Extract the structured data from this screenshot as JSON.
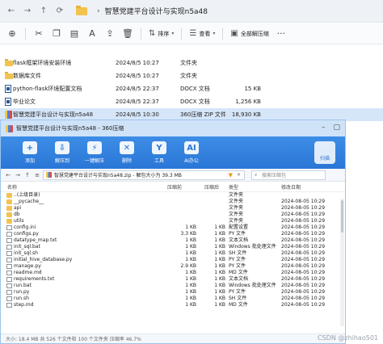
{
  "explorer": {
    "path": "智慧党建平台设计与实现n5a48",
    "toolbar": {
      "sort_label": "排序",
      "view_label": "查看",
      "extract_label": "全部解压缩"
    },
    "files": [
      {
        "name": "flask框架环境安装环境",
        "date": "2024/8/5 10:27",
        "type": "文件夹",
        "size": "",
        "icon": "folder"
      },
      {
        "name": "数据库文件",
        "date": "2024/8/5 10:27",
        "type": "文件夹",
        "size": "",
        "icon": "folder"
      },
      {
        "name": "python-flask环境配置文档",
        "date": "2024/8/5 22:37",
        "type": "DOCX 文档",
        "size": "15 KB",
        "icon": "doc"
      },
      {
        "name": "毕业论文",
        "date": "2024/8/5 22:37",
        "type": "DOCX 文档",
        "size": "1,256 KB",
        "icon": "doc"
      },
      {
        "name": "智慧党建平台设计与实现n5a48",
        "date": "2024/8/5 10:30",
        "type": "360压缩 ZIP 文件",
        "size": "18,930 KB",
        "icon": "zip"
      }
    ]
  },
  "zip": {
    "title": "智慧党建平台设计与实现n5a48 - 360压缩",
    "tools": [
      "添加",
      "解压到",
      "一键解压",
      "删除",
      "工具",
      "AI办公"
    ],
    "scan_label": "扫描",
    "address": "智慧党建平台设计与实现n5a48.zip - 解包大小为 39.3 MB",
    "search_placeholder": "搜索压缩包",
    "headers": {
      "name": "名称",
      "size": "压缩前",
      "compressed": "压缩后",
      "type": "类型",
      "modified": "修改日期"
    },
    "rows": [
      {
        "name": "..(上级目录)",
        "size": "",
        "compressed": "",
        "type": "文件夹",
        "modified": "",
        "icon": "folder"
      },
      {
        "name": "__pycache__",
        "size": "",
        "compressed": "",
        "type": "文件夹",
        "modified": "2024-08-05 10:29",
        "icon": "folder"
      },
      {
        "name": "api",
        "size": "",
        "compressed": "",
        "type": "文件夹",
        "modified": "2024-08-05 10:29",
        "icon": "folder"
      },
      {
        "name": "db",
        "size": "",
        "compressed": "",
        "type": "文件夹",
        "modified": "2024-08-05 10:29",
        "icon": "folder"
      },
      {
        "name": "utils",
        "size": "",
        "compressed": "",
        "type": "文件夹",
        "modified": "2024-08-05 10:29",
        "icon": "folder"
      },
      {
        "name": "config.ini",
        "size": "1 KB",
        "compressed": "1 KB",
        "type": "配置设置",
        "modified": "2024-08-05 10:29",
        "icon": "doc"
      },
      {
        "name": "configs.py",
        "size": "3.3 KB",
        "compressed": "1 KB",
        "type": "PY 文件",
        "modified": "2024-08-05 10:29",
        "icon": "doc"
      },
      {
        "name": "datatype_map.txt",
        "size": "1 KB",
        "compressed": "1 KB",
        "type": "文本文档",
        "modified": "2024-08-05 10:29",
        "icon": "doc"
      },
      {
        "name": "init_sql.bat",
        "size": "1 KB",
        "compressed": "1 KB",
        "type": "Windows 批处理文件",
        "modified": "2024-08-05 10:29",
        "icon": "doc"
      },
      {
        "name": "init_sql.sh",
        "size": "1 KB",
        "compressed": "1 KB",
        "type": "SH 文件",
        "modified": "2024-08-05 10:29",
        "icon": "doc"
      },
      {
        "name": "initial_hive_database.py",
        "size": "1 KB",
        "compressed": "1 KB",
        "type": "PY 文件",
        "modified": "2024-08-05 10:29",
        "icon": "doc"
      },
      {
        "name": "manage.py",
        "size": "2.9 KB",
        "compressed": "1 KB",
        "type": "PY 文件",
        "modified": "2024-08-05 10:29",
        "icon": "doc"
      },
      {
        "name": "readme.md",
        "size": "1 KB",
        "compressed": "1 KB",
        "type": "MD 文件",
        "modified": "2024-08-05 10:29",
        "icon": "doc"
      },
      {
        "name": "requirements.txt",
        "size": "1 KB",
        "compressed": "1 KB",
        "type": "文本文档",
        "modified": "2024-08-05 10:29",
        "icon": "doc"
      },
      {
        "name": "run.bat",
        "size": "1 KB",
        "compressed": "1 KB",
        "type": "Windows 批处理文件",
        "modified": "2024-08-05 10:29",
        "icon": "doc"
      },
      {
        "name": "run.py",
        "size": "1 KB",
        "compressed": "1 KB",
        "type": "PY 文件",
        "modified": "2024-08-05 10:29",
        "icon": "doc"
      },
      {
        "name": "run.sh",
        "size": "1 KB",
        "compressed": "1 KB",
        "type": "SH 文件",
        "modified": "2024-08-05 10:29",
        "icon": "doc"
      },
      {
        "name": "step.md",
        "size": "1 KB",
        "compressed": "1 KB",
        "type": "MD 文件",
        "modified": "2024-08-05 10:29",
        "icon": "doc"
      }
    ],
    "status": "大小: 18.4 MB 共 526 个文件和 100 个文件夹 压缩率 46.7%"
  },
  "watermark": "CSDN @zhihao501",
  "colors": {
    "accent": "#2a76d6",
    "selection": "#d6e6f9",
    "folder": "#f3c34f"
  }
}
